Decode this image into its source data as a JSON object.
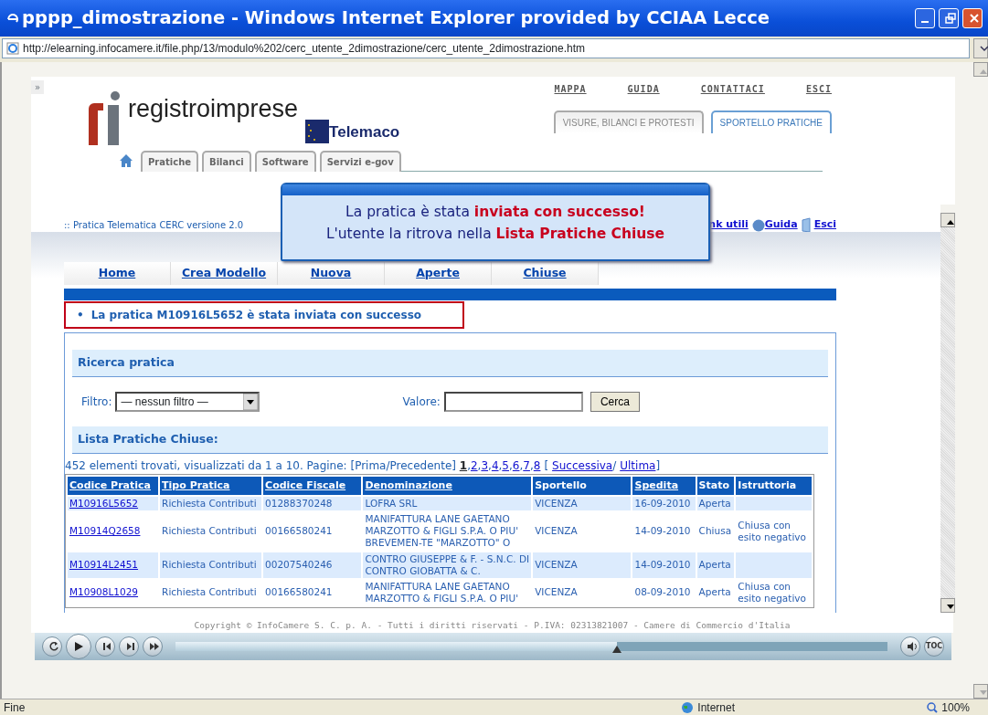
{
  "window": {
    "title": "pppp_dimostrazione - Windows Internet Explorer provided by CCIAA Lecce"
  },
  "expand_toggle": "»",
  "address": {
    "url": "http://elearning.infocamere.it/file.php/13/modulo%202/cerc_utente_2dimostrazione/cerc_utente_2dimostrazione.htm"
  },
  "header": {
    "logo_text": "registroimprese",
    "brand": "Telemaco",
    "top_links": [
      "MAPPA",
      "GUIDA",
      "CONTATTACI",
      "ESCI"
    ],
    "section_tabs": [
      {
        "label": "VISURE, BILANCI E PROTESTI",
        "selected": false
      },
      {
        "label": "SPORTELLO PRATICHE",
        "selected": true
      }
    ],
    "main_tabs": [
      "Pratiche",
      "Bilanci",
      "Software",
      "Servizi e-gov"
    ]
  },
  "subtitle": ":: Pratica Telematica CERC versione 2.0",
  "util_links": [
    {
      "label": "nk utili",
      "kind": "text"
    },
    {
      "label": "Guida",
      "kind": "help"
    },
    {
      "label": "Esci",
      "kind": "exit"
    }
  ],
  "nav_tabs": [
    "Home",
    "Crea Modello",
    "Nuova",
    "Aperte",
    "Chiuse"
  ],
  "message_bullet": "•",
  "message": "La pratica M10916L5652 è stata inviata con successo",
  "search": {
    "title": "Ricerca pratica",
    "filter_label": "Filtro:",
    "filter_value": "— nessun filtro —",
    "value_label": "Valore:",
    "button": "Cerca"
  },
  "list": {
    "title": "Lista Pratiche Chiuse:",
    "pager": {
      "summary": "452 elementi trovati, visualizzati da 1 a 10. Pagine: [Prima/Precedente]",
      "pages": [
        {
          "label": "1",
          "selected": true
        },
        {
          "label": "2",
          "selected": false
        },
        {
          "label": "3",
          "selected": false
        },
        {
          "label": "4",
          "selected": false
        },
        {
          "label": "5",
          "selected": false
        },
        {
          "label": "6",
          "selected": false
        },
        {
          "label": "7",
          "selected": false
        },
        {
          "label": "8",
          "selected": false
        }
      ],
      "separator": ",",
      "open": "[",
      "next": "Successiva",
      "slash": "/",
      "last": "Ultima",
      "close": "]"
    },
    "columns": [
      {
        "label": "Codice Pratica",
        "sortable": true
      },
      {
        "label": "Tipo Pratica",
        "sortable": true
      },
      {
        "label": "Codice Fiscale",
        "sortable": true
      },
      {
        "label": "Denominazione",
        "sortable": true
      },
      {
        "label": "Sportello",
        "sortable": false
      },
      {
        "label": "Spedita",
        "sortable": true
      },
      {
        "label": "Stato",
        "sortable": false
      },
      {
        "label": "Istruttoria",
        "sortable": false
      }
    ],
    "rows": [
      [
        "M10916L5652",
        "Richiesta Contributi",
        "01288370248",
        "LOFRA SRL",
        "VICENZA",
        "16-09-2010",
        "Aperta",
        ""
      ],
      [
        "M10914Q2658",
        "Richiesta Contributi",
        "00166580241",
        "MANIFATTURA LANE GAETANO MARZOTTO & FIGLI S.P.A. O PIU' BREVEMEN-TE \"MARZOTTO\" O",
        "VICENZA",
        "14-09-2010",
        "Chiusa",
        "Chiusa con esito negativo"
      ],
      [
        "M10914L2451",
        "Richiesta Contributi",
        "00207540246",
        "CONTRO GIUSEPPE & F. - S.N.C. DI CONTRO GIOBATTA & C.",
        "VICENZA",
        "14-09-2010",
        "Aperta",
        ""
      ],
      [
        "M10908L1029",
        "Richiesta Contributi",
        "00166580241",
        "MANIFATTURA LANE GAETANO MARZOTTO & FIGLI S.P.A. O PIU'",
        "VICENZA",
        "08-09-2010",
        "Aperta",
        "Chiusa con esito negativo"
      ]
    ]
  },
  "popup": {
    "lines": [
      "La pratica è stata **inviata con successo!**",
      "L'utente la ritrova nella **Lista Pratiche Chiuse**"
    ]
  },
  "copyright": "Copyright © InfoCamere S. C. p. A. - Tutti i diritti riservati - P.IVA: 02313821007 - Camere di Commercio d'Italia",
  "player": {
    "level": 0.62,
    "toc": "TOC"
  },
  "status_bar": {
    "text": "Fine",
    "zone": "Internet",
    "zoom": "100%"
  }
}
